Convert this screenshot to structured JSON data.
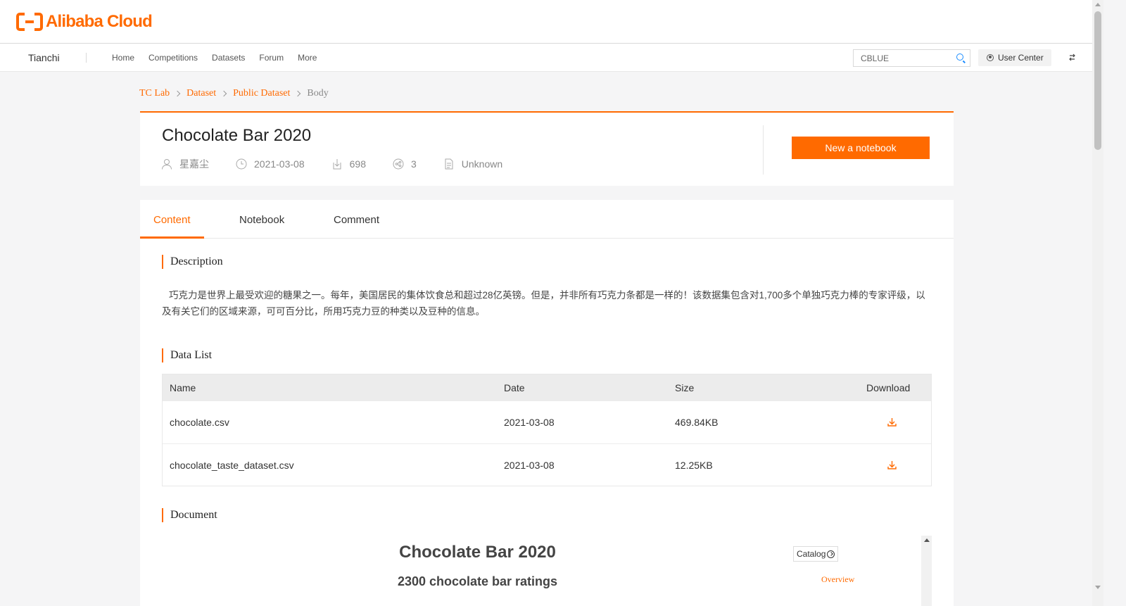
{
  "brand": {
    "logo_text": "Alibaba Cloud",
    "accent": "#ff6a00"
  },
  "nav": {
    "brand": "Tianchi",
    "links": [
      "Home",
      "Competitions",
      "Datasets",
      "Forum",
      "More"
    ],
    "search_value": "CBLUE",
    "user_center": "User Center"
  },
  "breadcrumb": {
    "items": [
      "TC Lab",
      "Dataset",
      "Public Dataset"
    ],
    "current": "Body"
  },
  "header": {
    "title": "Chocolate Bar 2020",
    "author": "星嘉尘",
    "date": "2021-03-08",
    "downloads": "698",
    "shares": "3",
    "license": "Unknown",
    "notebook_button": "New a notebook"
  },
  "tabs": [
    "Content",
    "Notebook",
    "Comment"
  ],
  "description": {
    "title": "Description",
    "text": "巧克力是世界上最受欢迎的糖果之一。每年，美国居民的集体饮食总和超过28亿英镑。但是，并非所有巧克力条都是一样的！该数据集包含对1,700多个单独巧克力棒的专家评级，以及有关它们的区域来源，可可百分比，所用巧克力豆的种类以及豆种的信息。"
  },
  "data_list": {
    "title": "Data List",
    "columns": [
      "Name",
      "Date",
      "Size",
      "Download"
    ],
    "rows": [
      {
        "name": "chocolate.csv",
        "date": "2021-03-08",
        "size": "469.84KB"
      },
      {
        "name": "chocolate_taste_dataset.csv",
        "date": "2021-03-08",
        "size": "12.25KB"
      }
    ]
  },
  "document": {
    "title": "Document",
    "doc_title": "Chocolate Bar 2020",
    "doc_subtitle": "2300 chocolate bar ratings",
    "catalog": "Catalog",
    "overview": "Overview"
  }
}
